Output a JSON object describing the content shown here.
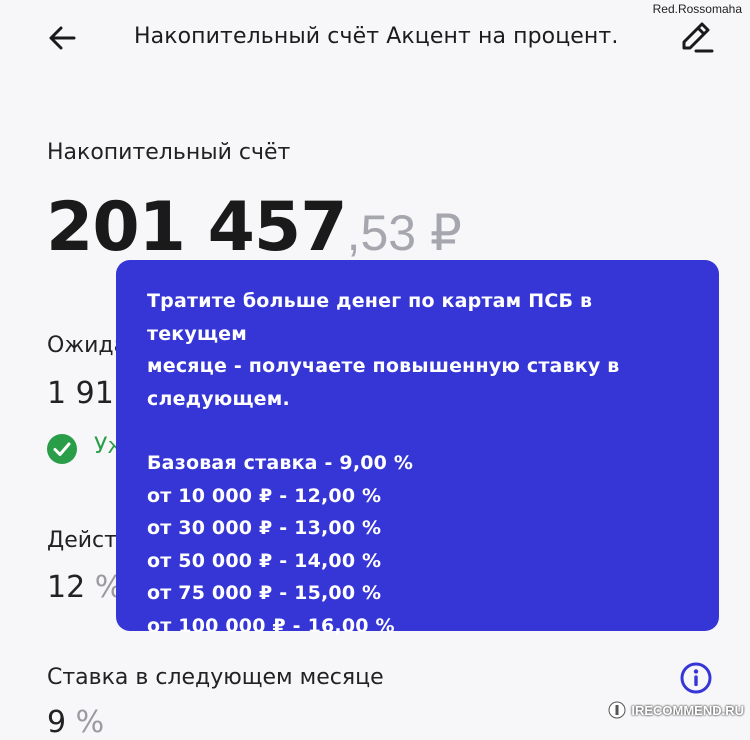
{
  "header": {
    "title": "Накопительный счёт Акцент на процент.",
    "back_icon": "arrow-left-icon",
    "edit_icon": "pencil-icon"
  },
  "watermark": {
    "author": "Red.Rossomaha",
    "site": "IRECOMMEND.RU"
  },
  "account": {
    "label": "Накопительный счёт",
    "balance_int": "201 457",
    "balance_frac": ",53 ₽"
  },
  "expected": {
    "label_partial": "Ожида",
    "value_partial": "1 91",
    "status_partial": "Уж"
  },
  "current_rate": {
    "label_partial": "Дейст",
    "value": "12",
    "unit": "%"
  },
  "next_rate": {
    "label": "Ставка в следующем месяце",
    "value": "9",
    "unit": "%"
  },
  "tooltip": {
    "intro_lines": [
      "Тратите больше денег по картам ПСБ в текущем",
      "месяце - получаете повышенную ставку в",
      "следующем."
    ],
    "tiers": [
      "Базовая ставка - 9,00 %",
      "от 10 000 ₽ - 12,00 %",
      "от 30 000 ₽ - 13,00 %",
      "от 50 000 ₽ - 14,00 %",
      "от 75 000 ₽ - 15,00 %",
      "от 100 000 ₽ - 16,00 %"
    ]
  },
  "colors": {
    "tooltip_bg": "#3636d6",
    "success": "#2a9d49",
    "info": "#3636d6",
    "muted": "#a6a6ae"
  }
}
